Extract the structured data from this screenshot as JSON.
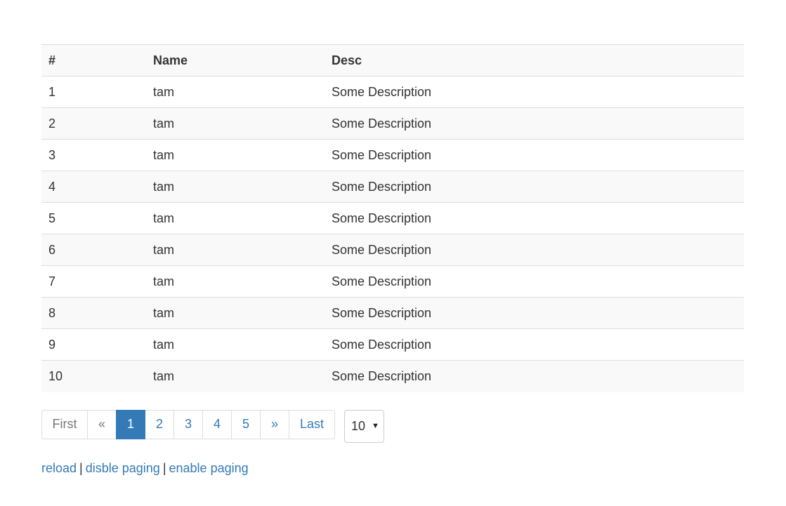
{
  "table": {
    "headers": [
      "#",
      "Name",
      "Desc"
    ],
    "rows": [
      {
        "num": "1",
        "name": "tam",
        "desc": "Some Description"
      },
      {
        "num": "2",
        "name": "tam",
        "desc": "Some Description"
      },
      {
        "num": "3",
        "name": "tam",
        "desc": "Some Description"
      },
      {
        "num": "4",
        "name": "tam",
        "desc": "Some Description"
      },
      {
        "num": "5",
        "name": "tam",
        "desc": "Some Description"
      },
      {
        "num": "6",
        "name": "tam",
        "desc": "Some Description"
      },
      {
        "num": "7",
        "name": "tam",
        "desc": "Some Description"
      },
      {
        "num": "8",
        "name": "tam",
        "desc": "Some Description"
      },
      {
        "num": "9",
        "name": "tam",
        "desc": "Some Description"
      },
      {
        "num": "10",
        "name": "tam",
        "desc": "Some Description"
      }
    ]
  },
  "pagination": {
    "first": "First",
    "prev": "«",
    "pages": [
      "1",
      "2",
      "3",
      "4",
      "5"
    ],
    "active_page": "1",
    "next": "»",
    "last": "Last"
  },
  "page_size": {
    "selected": "10",
    "caret_icon": "triangle-down"
  },
  "actions": {
    "reload": "reload",
    "separator": "|",
    "disable_paging": "disble paging",
    "enable_paging": "enable paging"
  },
  "colors": {
    "link": "#337ab7",
    "active_page_bg": "#337ab7",
    "stripe": "#f9f9f9",
    "border": "#dddddd"
  }
}
